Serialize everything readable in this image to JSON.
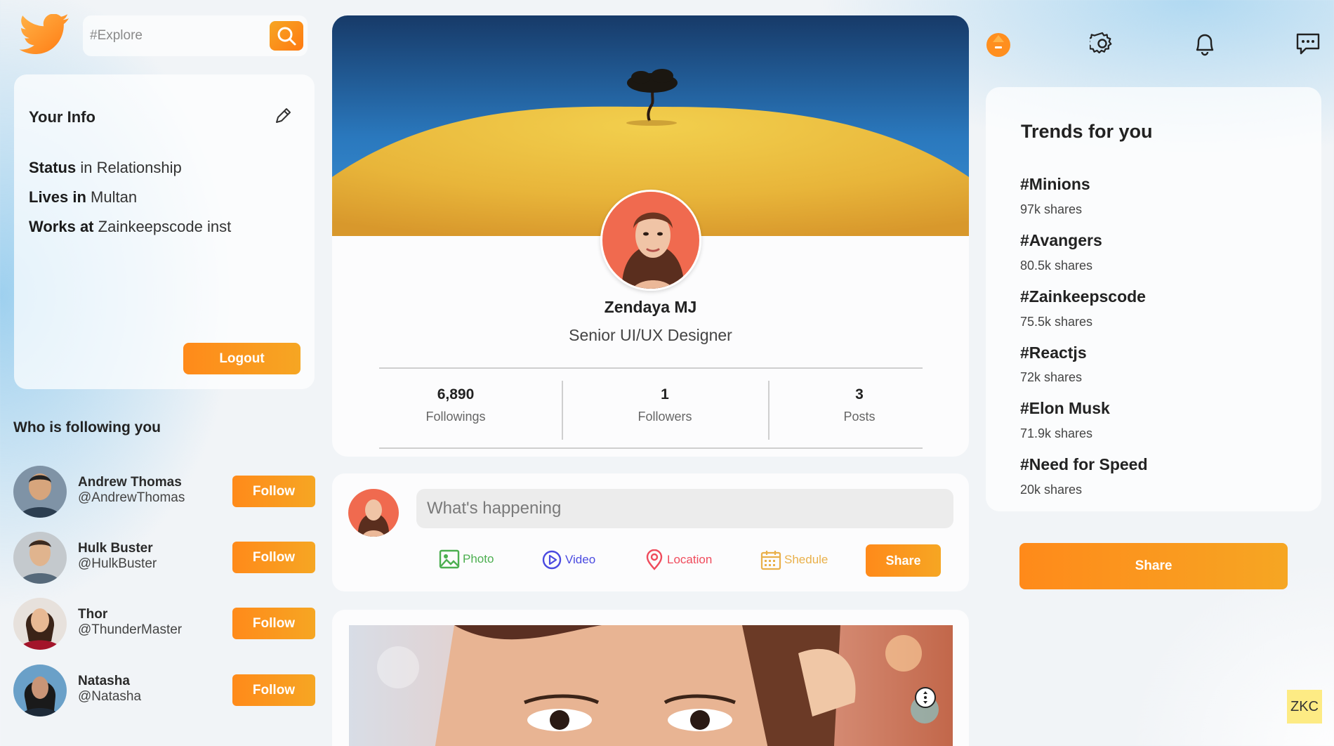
{
  "search": {
    "placeholder": "#Explore"
  },
  "info": {
    "title": "Your Info",
    "rows": [
      {
        "label": "Status",
        "value": "in Relationship"
      },
      {
        "label": "Lives in",
        "value": "Multan"
      },
      {
        "label": "Works at",
        "value": "Zainkeepscode inst"
      }
    ],
    "logout_label": "Logout"
  },
  "followers": {
    "title": "Who is following you",
    "follow_label": "Follow",
    "items": [
      {
        "name": "Andrew Thomas",
        "handle": "@AndrewThomas"
      },
      {
        "name": "Hulk Buster",
        "handle": "@HulkBuster"
      },
      {
        "name": "Thor",
        "handle": "@ThunderMaster"
      },
      {
        "name": "Natasha",
        "handle": "@Natasha"
      }
    ]
  },
  "profile": {
    "name": "Zendaya MJ",
    "role": "Senior UI/UX Designer",
    "stats": [
      {
        "value": "6,890",
        "label": "Followings"
      },
      {
        "value": "1",
        "label": "Followers"
      },
      {
        "value": "3",
        "label": "Posts"
      }
    ]
  },
  "post": {
    "placeholder": "What's happening",
    "options": [
      {
        "label": "Photo",
        "icon": "photo-icon",
        "color": "#4caf50"
      },
      {
        "label": "Video",
        "icon": "video-icon",
        "color": "#4a4ae0"
      },
      {
        "label": "Location",
        "icon": "location-icon",
        "color": "#ef4b5c"
      },
      {
        "label": "Shedule",
        "icon": "calendar-icon",
        "color": "#e9b04a"
      }
    ],
    "share_label": "Share"
  },
  "trends": {
    "title": "Trends for you",
    "items": [
      {
        "tag": "#Minions",
        "shares": "97k shares"
      },
      {
        "tag": "#Avangers",
        "shares": "80.5k shares"
      },
      {
        "tag": "#Zainkeepscode",
        "shares": "75.5k shares"
      },
      {
        "tag": "#Reactjs",
        "shares": "72k shares"
      },
      {
        "tag": "#Elon Musk",
        "shares": "71.9k shares"
      },
      {
        "tag": "#Need for Speed",
        "shares": "20k shares"
      }
    ]
  },
  "share_button_label": "Share",
  "watermark": "ZKC",
  "colors": {
    "accent": "#ff8a1a",
    "accent_light": "#f6a623",
    "brand_blue": "#1da1f2"
  }
}
